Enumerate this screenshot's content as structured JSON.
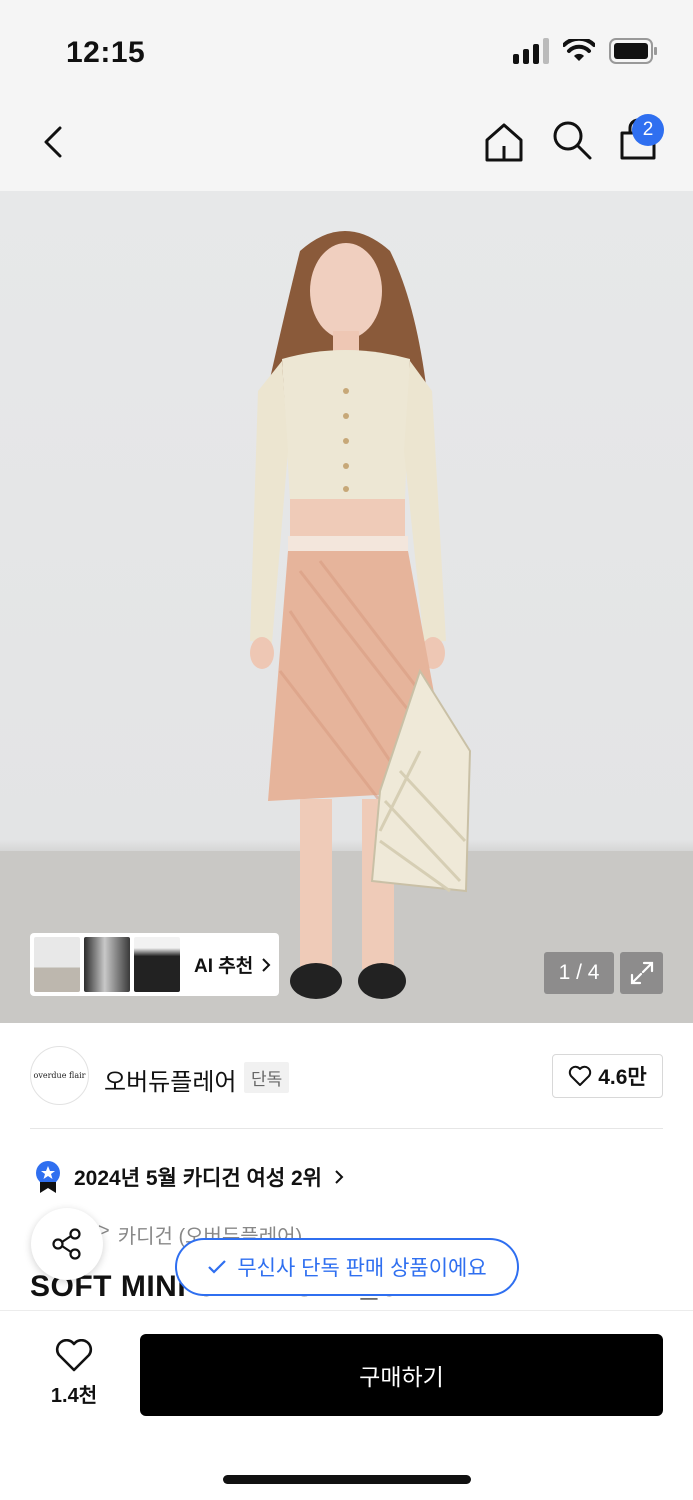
{
  "status_bar": {
    "time": "12:15"
  },
  "nav": {
    "cart_count": "2"
  },
  "gallery": {
    "ai_label": "AI 추천",
    "page_counter": "1 / 4"
  },
  "brand": {
    "logo_text": "overdue flair",
    "name": "오버듀플레어",
    "tag": "단독",
    "likes": "4.6만"
  },
  "ranking": {
    "text": "2024년 5월 카디건 여성 2위"
  },
  "category": {
    "separator": ">",
    "text": "카디건 (오버듀플레어)"
  },
  "product": {
    "title": "SOFT MINI CARDIGAN_CREAM"
  },
  "toast": {
    "text": "무신사 단독 판매 상품이에요"
  },
  "bottom": {
    "wish_count": "1.4천",
    "buy_label": "구매하기"
  },
  "colors": {
    "accent": "#2f6ff0",
    "buy_button": "#000000",
    "badge": "#2f6ff0"
  }
}
